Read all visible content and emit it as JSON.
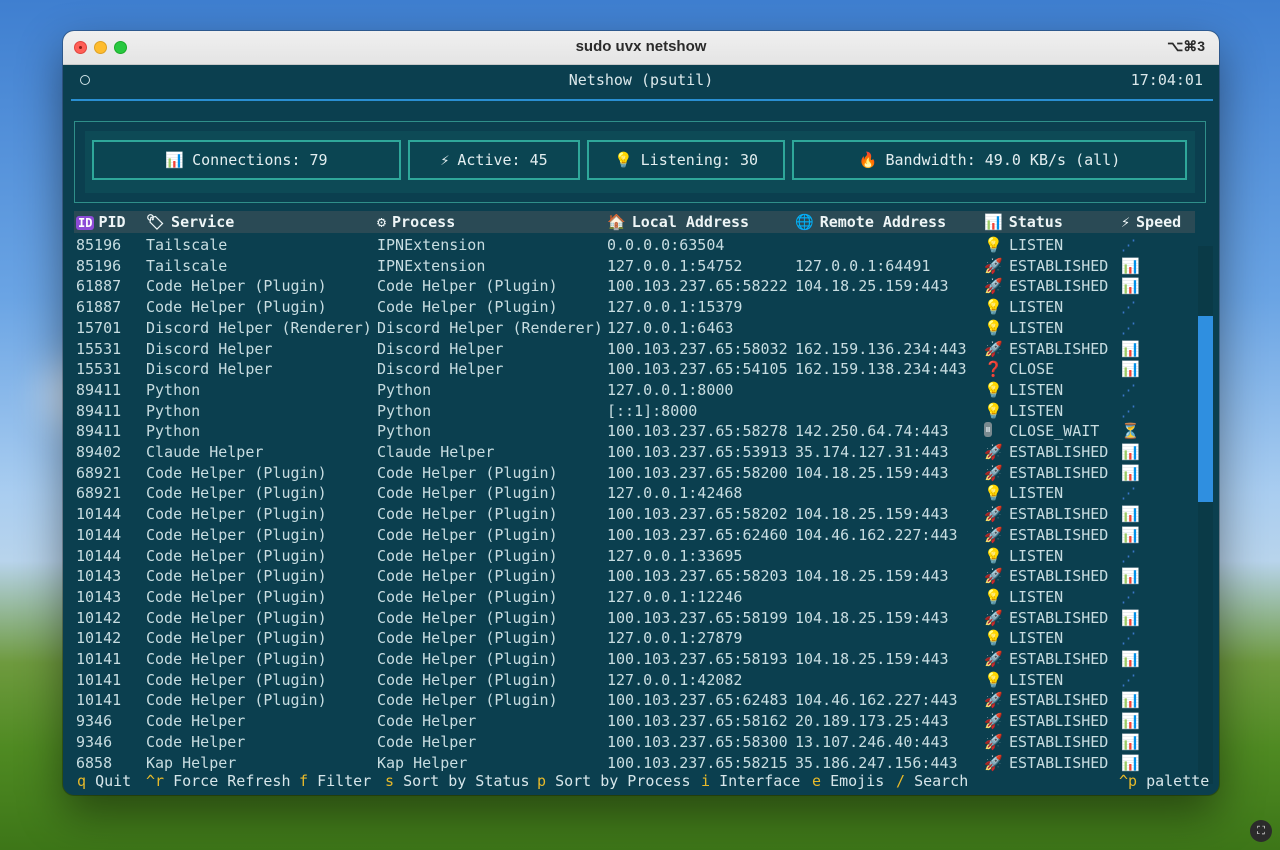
{
  "window": {
    "title": "sudo uvx netshow",
    "shortcut": "⌥⌘3"
  },
  "app": {
    "title": "Netshow (psutil)",
    "clock": "17:04:01"
  },
  "stats": [
    {
      "icon": "bar-chart-icon",
      "glyph": "📊",
      "label": "Connections: 79"
    },
    {
      "icon": "lightning-icon",
      "glyph": "⚡",
      "label": "Active: 45"
    },
    {
      "icon": "lightbulb-icon",
      "glyph": "💡",
      "label": "Listening: 30"
    },
    {
      "icon": "fire-icon",
      "glyph": "🔥",
      "label": "Bandwidth: 49.0 KB/s (all)"
    }
  ],
  "columns": {
    "pid": "PID",
    "service": "Service",
    "process": "Process",
    "local": "Local Address",
    "remote": "Remote Address",
    "status": "Status",
    "speed": "Speed"
  },
  "rows": [
    {
      "pid": "85196",
      "service": "Tailscale",
      "process": "IPNExtension",
      "local": "0.0.0.0:63504",
      "remote": "",
      "status": "LISTEN",
      "speed": "flat"
    },
    {
      "pid": "85196",
      "service": "Tailscale",
      "process": "IPNExtension",
      "local": "127.0.0.1:54752",
      "remote": "127.0.0.1:64491",
      "status": "ESTABLISHED",
      "speed": "chart"
    },
    {
      "pid": "61887",
      "service": "Code Helper (Plugin)",
      "process": "Code Helper (Plugin)",
      "local": "100.103.237.65:58222",
      "remote": "104.18.25.159:443",
      "status": "ESTABLISHED",
      "speed": "chart"
    },
    {
      "pid": "61887",
      "service": "Code Helper (Plugin)",
      "process": "Code Helper (Plugin)",
      "local": "127.0.0.1:15379",
      "remote": "",
      "status": "LISTEN",
      "speed": "flat"
    },
    {
      "pid": "15701",
      "service": "Discord Helper (Renderer)",
      "process": "Discord Helper (Renderer)",
      "local": "127.0.0.1:6463",
      "remote": "",
      "status": "LISTEN",
      "speed": "flat"
    },
    {
      "pid": "15531",
      "service": "Discord Helper",
      "process": "Discord Helper",
      "local": "100.103.237.65:58032",
      "remote": "162.159.136.234:443",
      "status": "ESTABLISHED",
      "speed": "chart"
    },
    {
      "pid": "15531",
      "service": "Discord Helper",
      "process": "Discord Helper",
      "local": "100.103.237.65:54105",
      "remote": "162.159.138.234:443",
      "status": "CLOSE",
      "speed": "chart"
    },
    {
      "pid": "89411",
      "service": "Python",
      "process": "Python",
      "local": "127.0.0.1:8000",
      "remote": "",
      "status": "LISTEN",
      "speed": "flat"
    },
    {
      "pid": "89411",
      "service": "Python",
      "process": "Python",
      "local": "[::1]:8000",
      "remote": "",
      "status": "LISTEN",
      "speed": "flat"
    },
    {
      "pid": "89411",
      "service": "Python",
      "process": "Python",
      "local": "100.103.237.65:58278",
      "remote": "142.250.64.74:443",
      "status": "CLOSE_WAIT",
      "speed": "hourglass"
    },
    {
      "pid": "89402",
      "service": "Claude Helper",
      "process": "Claude Helper",
      "local": "100.103.237.65:53913",
      "remote": "35.174.127.31:443",
      "status": "ESTABLISHED",
      "speed": "chart"
    },
    {
      "pid": "68921",
      "service": "Code Helper (Plugin)",
      "process": "Code Helper (Plugin)",
      "local": "100.103.237.65:58200",
      "remote": "104.18.25.159:443",
      "status": "ESTABLISHED",
      "speed": "chart"
    },
    {
      "pid": "68921",
      "service": "Code Helper (Plugin)",
      "process": "Code Helper (Plugin)",
      "local": "127.0.0.1:42468",
      "remote": "",
      "status": "LISTEN",
      "speed": "flat"
    },
    {
      "pid": "10144",
      "service": "Code Helper (Plugin)",
      "process": "Code Helper (Plugin)",
      "local": "100.103.237.65:58202",
      "remote": "104.18.25.159:443",
      "status": "ESTABLISHED",
      "speed": "chart"
    },
    {
      "pid": "10144",
      "service": "Code Helper (Plugin)",
      "process": "Code Helper (Plugin)",
      "local": "100.103.237.65:62460",
      "remote": "104.46.162.227:443",
      "status": "ESTABLISHED",
      "speed": "chart"
    },
    {
      "pid": "10144",
      "service": "Code Helper (Plugin)",
      "process": "Code Helper (Plugin)",
      "local": "127.0.0.1:33695",
      "remote": "",
      "status": "LISTEN",
      "speed": "flat"
    },
    {
      "pid": "10143",
      "service": "Code Helper (Plugin)",
      "process": "Code Helper (Plugin)",
      "local": "100.103.237.65:58203",
      "remote": "104.18.25.159:443",
      "status": "ESTABLISHED",
      "speed": "chart"
    },
    {
      "pid": "10143",
      "service": "Code Helper (Plugin)",
      "process": "Code Helper (Plugin)",
      "local": "127.0.0.1:12246",
      "remote": "",
      "status": "LISTEN",
      "speed": "flat"
    },
    {
      "pid": "10142",
      "service": "Code Helper (Plugin)",
      "process": "Code Helper (Plugin)",
      "local": "100.103.237.65:58199",
      "remote": "104.18.25.159:443",
      "status": "ESTABLISHED",
      "speed": "chart"
    },
    {
      "pid": "10142",
      "service": "Code Helper (Plugin)",
      "process": "Code Helper (Plugin)",
      "local": "127.0.0.1:27879",
      "remote": "",
      "status": "LISTEN",
      "speed": "flat"
    },
    {
      "pid": "10141",
      "service": "Code Helper (Plugin)",
      "process": "Code Helper (Plugin)",
      "local": "100.103.237.65:58193",
      "remote": "104.18.25.159:443",
      "status": "ESTABLISHED",
      "speed": "chart"
    },
    {
      "pid": "10141",
      "service": "Code Helper (Plugin)",
      "process": "Code Helper (Plugin)",
      "local": "127.0.0.1:42082",
      "remote": "",
      "status": "LISTEN",
      "speed": "flat"
    },
    {
      "pid": "10141",
      "service": "Code Helper (Plugin)",
      "process": "Code Helper (Plugin)",
      "local": "100.103.237.65:62483",
      "remote": "104.46.162.227:443",
      "status": "ESTABLISHED",
      "speed": "chart"
    },
    {
      "pid": "9346",
      "service": "Code Helper",
      "process": "Code Helper",
      "local": "100.103.237.65:58162",
      "remote": "20.189.173.25:443",
      "status": "ESTABLISHED",
      "speed": "chart"
    },
    {
      "pid": "9346",
      "service": "Code Helper",
      "process": "Code Helper",
      "local": "100.103.237.65:58300",
      "remote": "13.107.246.40:443",
      "status": "ESTABLISHED",
      "speed": "chart"
    },
    {
      "pid": "6858",
      "service": "Kap Helper",
      "process": "Kap Helper",
      "local": "100.103.237.65:58215",
      "remote": "35.186.247.156:443",
      "status": "ESTABLISHED",
      "speed": "chart"
    }
  ],
  "footer": [
    {
      "key": "q",
      "label": "Quit"
    },
    {
      "key": "^r",
      "label": "Force Refresh"
    },
    {
      "key": "f",
      "label": "Filter"
    },
    {
      "key": "s",
      "label": "Sort by Status"
    },
    {
      "key": "p",
      "label": "Sort by Process"
    },
    {
      "key": "i",
      "label": "Interface"
    },
    {
      "key": "e",
      "label": "Emojis"
    },
    {
      "key": "/",
      "label": "Search"
    }
  ],
  "footer_right": {
    "key": "^p",
    "label": "palette"
  },
  "scroll": {
    "position_fraction": 0.13,
    "visible_fraction": 0.35
  },
  "colors": {
    "terminal_bg": "#0b3f4f",
    "accent_border": "#2fa79a",
    "key_highlight": "#e7b92a",
    "header_line": "#2a8fd2"
  }
}
